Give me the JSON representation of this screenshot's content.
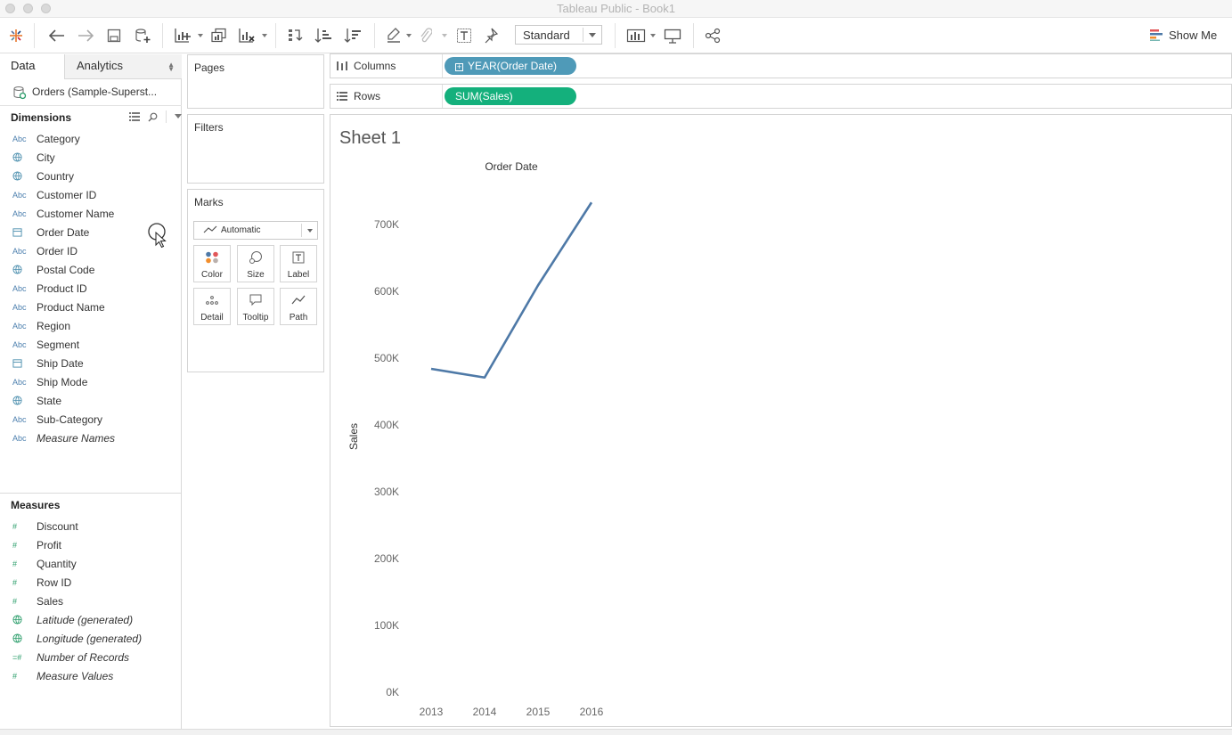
{
  "window": {
    "title": "Tableau Public - Book1"
  },
  "toolbar": {
    "fit_select": "Standard",
    "show_me": "Show Me",
    "icons": [
      "tableau-logo-icon",
      "back-icon",
      "forward-icon",
      "save-icon",
      "new-datasource-icon",
      "new-worksheet-icon",
      "duplicate-sheet-icon",
      "clear-sheet-icon",
      "swap-icon",
      "sort-ascending-icon",
      "sort-descending-icon",
      "highlight-icon",
      "paperclip-icon",
      "label-icon",
      "pin-icon",
      "bar-chart-icon",
      "presentation-icon",
      "share-icon"
    ]
  },
  "data_pane": {
    "tabs": {
      "data": "Data",
      "analytics": "Analytics"
    },
    "datasource": "Orders (Sample-Superst...",
    "dimensions_header": "Dimensions",
    "measures_header": "Measures",
    "dimensions": [
      {
        "icon": "Abc",
        "label": "Category"
      },
      {
        "icon": "globe",
        "label": "City"
      },
      {
        "icon": "globe",
        "label": "Country"
      },
      {
        "icon": "Abc",
        "label": "Customer ID"
      },
      {
        "icon": "Abc",
        "label": "Customer Name"
      },
      {
        "icon": "calendar",
        "label": "Order Date"
      },
      {
        "icon": "Abc",
        "label": "Order ID"
      },
      {
        "icon": "globe",
        "label": "Postal Code"
      },
      {
        "icon": "Abc",
        "label": "Product ID"
      },
      {
        "icon": "Abc",
        "label": "Product Name"
      },
      {
        "icon": "Abc",
        "label": "Region"
      },
      {
        "icon": "Abc",
        "label": "Segment"
      },
      {
        "icon": "calendar",
        "label": "Ship Date"
      },
      {
        "icon": "Abc",
        "label": "Ship Mode"
      },
      {
        "icon": "globe",
        "label": "State"
      },
      {
        "icon": "Abc",
        "label": "Sub-Category"
      },
      {
        "icon": "Abc",
        "label": "Measure Names",
        "italic": true
      }
    ],
    "measures": [
      {
        "icon": "hash",
        "label": "Discount"
      },
      {
        "icon": "hash",
        "label": "Profit"
      },
      {
        "icon": "hash",
        "label": "Quantity"
      },
      {
        "icon": "hash",
        "label": "Row ID"
      },
      {
        "icon": "hash",
        "label": "Sales"
      },
      {
        "icon": "globe",
        "label": "Latitude (generated)",
        "italic": true
      },
      {
        "icon": "hash-eq",
        "label": "Longitude (generated)",
        "italic": true
      },
      {
        "icon": "hash-eq",
        "label": "Number of Records",
        "italic": true
      },
      {
        "icon": "hash",
        "label": "Measure Values",
        "italic": true
      }
    ]
  },
  "cards": {
    "pages": "Pages",
    "filters": "Filters",
    "marks": "Marks",
    "mark_type": "Automatic",
    "mark_buttons": [
      "Color",
      "Size",
      "Label",
      "Detail",
      "Tooltip",
      "Path"
    ]
  },
  "shelves": {
    "columns_label": "Columns",
    "columns_pill": "YEAR(Order Date)",
    "rows_label": "Rows",
    "rows_pill": "SUM(Sales)"
  },
  "sheet": {
    "title": "Sheet 1"
  },
  "colors": {
    "line": "#4e79a7",
    "columns_pill": "#4f9ab8",
    "rows_pill": "#14b07c"
  },
  "chart_data": {
    "type": "line",
    "title": "Order Date",
    "xlabel": "",
    "ylabel": "Sales",
    "categories": [
      "2013",
      "2014",
      "2015",
      "2016"
    ],
    "series": [
      {
        "values": [
          484000,
          471000,
          609000,
          733000
        ]
      }
    ],
    "ylim": [
      0,
      750000
    ],
    "yticks": [
      0,
      100000,
      200000,
      300000,
      400000,
      500000,
      600000,
      700000
    ],
    "ytick_labels": [
      "0K",
      "100K",
      "200K",
      "300K",
      "400K",
      "500K",
      "600K",
      "700K"
    ],
    "grid": false,
    "legend": "none"
  }
}
